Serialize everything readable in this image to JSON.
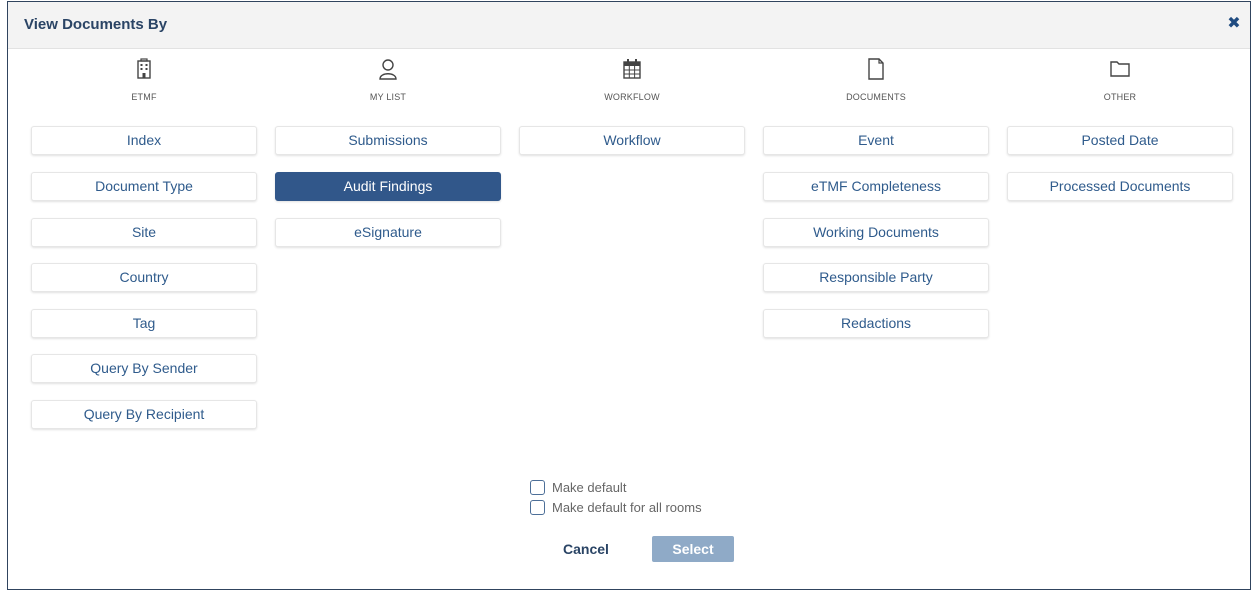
{
  "dialog": {
    "title": "View Documents By",
    "close_icon": "close-icon"
  },
  "columns": [
    {
      "label": "ETMF",
      "icon": "building-icon",
      "options": [
        "Index",
        "Document Type",
        "Site",
        "Country",
        "Tag",
        "Query By Sender",
        "Query By Recipient"
      ]
    },
    {
      "label": "MY LIST",
      "icon": "user-icon",
      "options": [
        "Submissions",
        "Audit Findings",
        "eSignature"
      ]
    },
    {
      "label": "WORKFLOW",
      "icon": "calendar-icon",
      "options": [
        "Workflow"
      ]
    },
    {
      "label": "DOCUMENTS",
      "icon": "document-icon",
      "options": [
        "Event",
        "eTMF Completeness",
        "Working Documents",
        "Responsible Party",
        "Redactions"
      ]
    },
    {
      "label": "OTHER",
      "icon": "folder-icon",
      "options": [
        "Posted Date",
        "Processed Documents"
      ]
    }
  ],
  "selected_option": "Audit Findings",
  "checkboxes": {
    "make_default": {
      "label": "Make default",
      "checked": false
    },
    "make_default_all": {
      "label": "Make default for all rooms",
      "checked": false
    }
  },
  "footer": {
    "cancel_label": "Cancel",
    "select_label": "Select"
  },
  "colors": {
    "accent": "#31578a",
    "select_disabled": "#8faac7",
    "text_link": "#2f5b8c"
  }
}
